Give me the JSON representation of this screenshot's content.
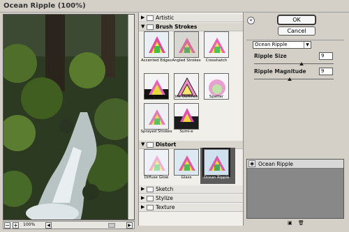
{
  "window": {
    "title": "Ocean Ripple (100%)"
  },
  "preview": {
    "zoom": "100%",
    "zoom_minus": "−",
    "zoom_plus": "+",
    "scroll_left": "◀",
    "scroll_right": "▶"
  },
  "browser": {
    "categories": [
      {
        "label": "Artistic",
        "expanded": false
      },
      {
        "label": "Brush Strokes",
        "expanded": true
      },
      {
        "label": "Distort",
        "expanded": true
      },
      {
        "label": "Sketch",
        "expanded": false
      },
      {
        "label": "Stylize",
        "expanded": false
      },
      {
        "label": "Texture",
        "expanded": false
      }
    ],
    "brush_strokes": [
      "Accented Edges",
      "Angled Strokes",
      "Crosshatch",
      "Dark Strokes",
      "Ink Outlines",
      "Spatter",
      "Sprayed Strokes",
      "Sumi-e"
    ],
    "distort": [
      "Diffuse Glow",
      "Glass",
      "Ocean Ripple"
    ],
    "selected": "Ocean Ripple"
  },
  "buttons": {
    "ok": "OK",
    "cancel": "Cancel",
    "help": "«"
  },
  "filter_select": {
    "value": "Ocean Ripple"
  },
  "params": {
    "ripple_size": {
      "label": "Ripple Size",
      "value": "9",
      "level": 0.6
    },
    "ripple_magnitude": {
      "label": "Ripple Magnitude",
      "value": "9",
      "level": 0.45
    }
  },
  "layers": {
    "items": [
      "Ocean Ripple"
    ],
    "new_icon": "new-layer-icon",
    "delete_icon": "trash-icon"
  },
  "colors": {
    "chrome": "#d4d0c8",
    "panel": "#f0efea",
    "selected": "#5c5c5c"
  }
}
